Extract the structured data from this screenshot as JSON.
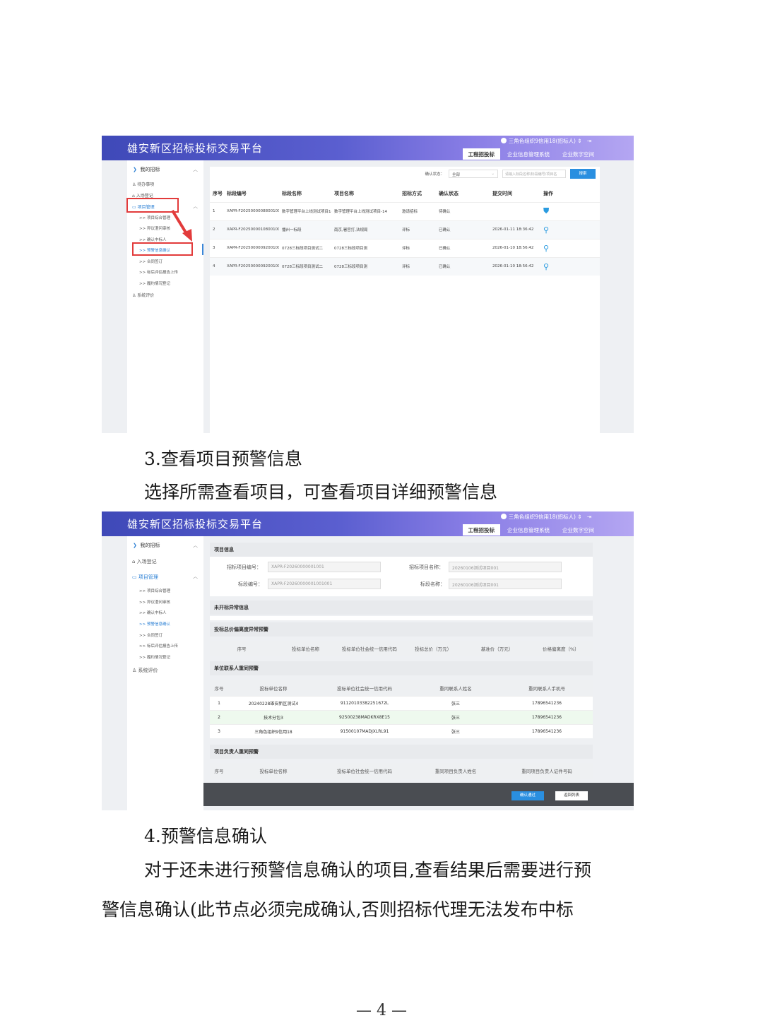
{
  "screen1": {
    "platform_title": "雄安新区招标投标交易平台",
    "user": "三角色组织9信用18(招标人)",
    "tabs": [
      "工程招投标",
      "企业信息管理系统",
      "企业数字空间"
    ],
    "sidebar": {
      "group": "我的招标",
      "items": [
        "待办事项",
        "入场登记",
        "项目管理"
      ],
      "subitems": [
        "项目综合管理",
        "异议澄问审核",
        "确认中标人",
        "预警信息确认",
        "合同签订",
        "标后评估报告上传",
        "履约情况登记"
      ],
      "last": "系统评价"
    },
    "filter": {
      "label": "确认状态：",
      "select": "全部",
      "placeholder": "请输入标段名称/标段编号/项目名",
      "button": "搜索"
    },
    "table": {
      "headers": [
        "序号",
        "标段编号",
        "标段名称",
        "项目名称",
        "招标方式",
        "确认状态",
        "提交时间",
        "操作"
      ],
      "rows": [
        [
          "1",
          "XAPR-F20250000088001001",
          "数字管理平台上线测试项目14",
          "数字管理平台上线测试项目-14",
          "邀请招标",
          "待确认",
          "",
          "shield-icon"
        ],
        [
          "2",
          "XAPR-F20250000108001001",
          "播州一标段",
          "南京,署官打,法规局",
          "评标",
          "已确认",
          "2026-01-11 18:36:42",
          "search-icon"
        ],
        [
          "3",
          "XAPR-F20250000092001002",
          "0728三标段项目测试二",
          "0728三标段项目测",
          "评标",
          "已确认",
          "2026-01-10 18:56:42",
          "search-icon"
        ],
        [
          "4",
          "XAPR-F20250000092001002",
          "0728三标段项目测试二",
          "0728三标段项目测",
          "评标",
          "已确认",
          "2026-01-10 18:56:42",
          "search-icon"
        ]
      ]
    }
  },
  "section3": {
    "heading": "3.查看项目预警信息",
    "text": "选择所需查看项目，可查看项目详细预警信息"
  },
  "screen2": {
    "platform_title": "雄安新区招标投标交易平台",
    "user": "三角色组织9信用18(招标人)",
    "tabs": [
      "工程招投标",
      "企业信息管理系统",
      "企业数字空间"
    ],
    "sidebar": {
      "group": "我的招标",
      "items": [
        "入场登记",
        "项目管理"
      ],
      "subitems": [
        "项目综合管理",
        "异议澄问审核",
        "确认中标人",
        "预警信息确认",
        "合同签订",
        "标后评估报告上传",
        "履约情况登记"
      ],
      "last": "系统评价"
    },
    "project_info": {
      "title": "项目信息",
      "proj_no_label": "招标项目编号：",
      "proj_no": "XAPR-F20260000001001",
      "proj_name_label": "招标项目名称：",
      "proj_name": "20260106测试项目001",
      "sec_no_label": "标段编号：",
      "sec_no": "XAPR-F20260000001001001",
      "sec_name_label": "标段名称：",
      "sec_name": "20260106测试项目001"
    },
    "section_unopened": "未开标异常信息",
    "section_price": "投标总价偏离度异常预警",
    "price_headers": [
      "序号",
      "投标单位名称",
      "投标单位社会统一信用代码",
      "投标总价（万元）",
      "基准价（万元）",
      "价格偏离度（%）"
    ],
    "section_contact": "单位联系人重同预警",
    "contact_headers": [
      "序号",
      "投标单位名称",
      "投标单位社会统一信用代码",
      "重同联系人姓名",
      "重同联系人手机号"
    ],
    "contact_rows": [
      [
        "1",
        "20240228雄安新区测试4",
        "91120103382251672L",
        "张三",
        "17896541236"
      ],
      [
        "2",
        "技术分包3",
        "92500238MADKRX8E15",
        "张三",
        "17896541236"
      ],
      [
        "3",
        "三角色组织9信用18",
        "91500107MADJXLRL91",
        "张三",
        "17896541236"
      ]
    ],
    "section_leader": "项目负责人重同预警",
    "leader_headers": [
      "序号",
      "投标单位名称",
      "投标单位社会统一信用代码",
      "重同项目负责人姓名",
      "重同项目负责人证件号码"
    ],
    "confirm_button": "确认通过",
    "back_button": "返回列表"
  },
  "section4": {
    "heading": "4.预警信息确认",
    "line1": "对于还未进行预警信息确认的项目,查看结果后需要进行预",
    "line2": "警信息确认(此节点必须完成确认,否则招标代理无法发布中标"
  },
  "page_number": "— 4 —"
}
